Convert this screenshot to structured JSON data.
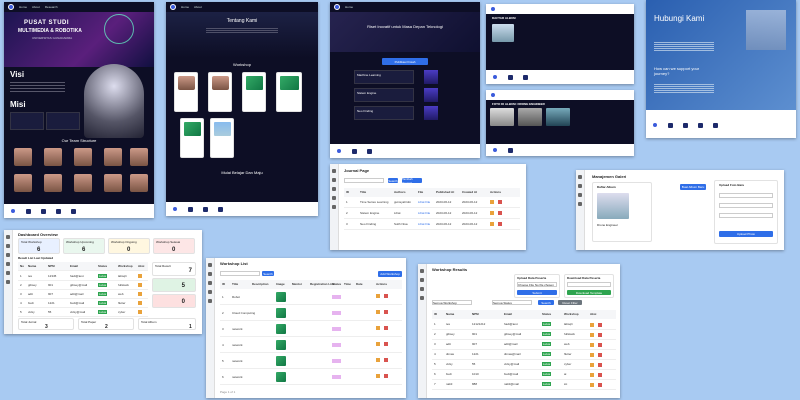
{
  "home": {
    "hero_title": "PUSAT STUDI",
    "hero_title2": "MULTIMEDIA & ROBOTIKA",
    "hero_sub": "UNIVERSITAS GUNADARMA",
    "visi": "Visi",
    "misi": "Misi",
    "team": "Our Team Structure"
  },
  "about": {
    "title": "Tentang Kami",
    "workshop": "Workshop",
    "tagline": "Mulai Belajar Dan Maju"
  },
  "research": {
    "title": "Riset Inovatif untuk Masa Depan Teknologi",
    "publication": "Publikasi Ilmiah",
    "pubs": [
      "Machine Learning",
      "Sistem Engine",
      "Neo Finding"
    ]
  },
  "gallery": {
    "title": "DAFTAR ALBUM",
    "subtitle": "FOTO DI ALBUM: DRONE ENGINEER"
  },
  "contact": {
    "title": "Hubungi Kami",
    "question": "How can we support your journey?"
  },
  "journal": {
    "title": "Journal Page",
    "search_btn": "Search",
    "add_btn": "Tambah Journal",
    "columns": [
      "ID",
      "Title",
      "Authors",
      "File",
      "Published At",
      "Created At",
      "Actions"
    ],
    "rows": [
      [
        "1",
        "Time Series Learning",
        "guinsyahrdm",
        "Lihat File",
        "2023-06-12",
        "2023-06-12"
      ],
      [
        "2",
        "Sistem Engine",
        "Lihat",
        "Lihat File",
        "2023-06-12",
        "2023-06-12"
      ],
      [
        "3",
        "Neo Finding",
        "Sulih Nisa",
        "Lihat File",
        "2023-06-12",
        "2023-06-12"
      ]
    ]
  },
  "album": {
    "title": "Manajemen Galeri",
    "list_title": "Daftar Album",
    "create_btn": "Buat Album Baru",
    "form_title": "Upload Foto Baru",
    "album_name": "Drone Engineer",
    "upload_btn": "Upload Photo"
  },
  "dashboard": {
    "title": "Dashboard Overview",
    "stats": [
      {
        "label": "Total Workshop",
        "value": "6"
      },
      {
        "label": "Workshop Upcoming",
        "value": "6"
      },
      {
        "label": "Workshop Ongoing",
        "value": "0"
      },
      {
        "label": "Workshop Selesai",
        "value": "0"
      }
    ],
    "result_title": "Result List Last Updated",
    "total_result": "Total Result",
    "total_result_value": "7",
    "side_values": [
      "5",
      "0"
    ],
    "bottom_labels": [
      "Total Jurnal",
      "Total Paper",
      "Total Album"
    ],
    "bottom_values": [
      "3",
      "2",
      "1"
    ],
    "columns": [
      "No",
      "Nama",
      "NPM",
      "Email",
      "Status",
      "Workshop",
      "Aksi"
    ],
    "rows": [
      [
        "1",
        "tes",
        "12345",
        "hadi@test",
        "Lulus",
        "labsqli"
      ],
      [
        "2",
        "gibsey",
        "901",
        "gibsey@mail",
        "Lulus",
        "fullstack"
      ],
      [
        "3",
        "adit",
        "907",
        "adit@mail",
        "Lulus",
        "web"
      ],
      [
        "4",
        "budi",
        "1221",
        "budi@mail",
        "Lulus",
        "flutter"
      ],
      [
        "5",
        "vicky",
        "55",
        "vicky@mail",
        "Lulus",
        "cyber"
      ]
    ]
  },
  "workshop_list": {
    "title": "Workshop List",
    "add_btn": "Add Workshop",
    "search_btn": "Search",
    "columns": [
      "ID",
      "Title",
      "Description",
      "Image",
      "Mentor",
      "Registration Link",
      "Status",
      "Time",
      "Date",
      "Actions"
    ],
    "rows": [
      [
        "1",
        "Robot"
      ],
      [
        "2",
        "Cloud Computing"
      ],
      [
        "3",
        "network"
      ],
      [
        "4",
        "network"
      ],
      [
        "5",
        "network"
      ],
      [
        "6",
        "network"
      ]
    ],
    "footer": "Page 1 of 1"
  },
  "results": {
    "title": "Workshop Results",
    "upload_title": "Upload Data Peserta",
    "download_title": "Download Data Peserta",
    "choose_file": "Choose File",
    "no_file": "No file chosen",
    "submit_btn": "Submit",
    "download_btn": "Download Template",
    "filter_label": "Semua Workshop",
    "status_label": "Semua Status",
    "search_btn": "Search",
    "reset_btn": "Reset Filter",
    "columns": [
      "ID",
      "Nama",
      "NPM",
      "Email",
      "Status",
      "Workshop",
      "Aksi"
    ],
    "rows": [
      [
        "1",
        "tes",
        "12121212",
        "hadi@test",
        "Lulus",
        "labsqli"
      ],
      [
        "2",
        "gibsey",
        "901",
        "gibsey@mail",
        "Lulus",
        "fullstack"
      ],
      [
        "3",
        "adit",
        "907",
        "adit@mail",
        "Lulus",
        "web"
      ],
      [
        "4",
        "dimas",
        "1221",
        "dimas@mail",
        "Lulus",
        "flutter"
      ],
      [
        "5",
        "vicky",
        "55",
        "vicky@mail",
        "Lulus",
        "cyber"
      ],
      [
        "6",
        "budi",
        "1010",
        "budi@mail",
        "Lulus",
        "ai"
      ],
      [
        "7",
        "nabil",
        "888",
        "nabil@mail",
        "Lulus",
        "iot"
      ]
    ]
  },
  "colors": {
    "primary": "#2f6ee8",
    "success": "#2ea44f",
    "danger": "#d9534f",
    "bg": "#a8caf2",
    "dark": "#0d0e25"
  }
}
